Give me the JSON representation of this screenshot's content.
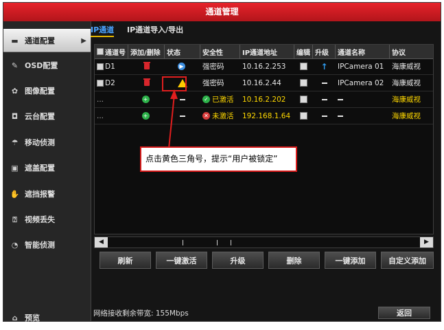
{
  "window": {
    "title": "通道管理"
  },
  "sidebar": {
    "items": [
      {
        "label": "通道配置",
        "icon": "camera-icon"
      },
      {
        "label": "OSD配置",
        "icon": "osd-icon"
      },
      {
        "label": "图像配置",
        "icon": "image-settings-icon"
      },
      {
        "label": "云台配置",
        "icon": "ptz-icon"
      },
      {
        "label": "移动侦测",
        "icon": "motion-detection-icon"
      },
      {
        "label": "遮盖配置",
        "icon": "privacy-mask-icon"
      },
      {
        "label": "遮挡报警",
        "icon": "tamper-alarm-icon"
      },
      {
        "label": "视频丢失",
        "icon": "video-loss-icon"
      },
      {
        "label": "智能侦测",
        "icon": "smart-detection-icon"
      }
    ],
    "preview_label": "预览"
  },
  "tabs": [
    {
      "label": "IP通道",
      "active": true
    },
    {
      "label": "IP通道导入/导出",
      "active": false
    }
  ],
  "table": {
    "headers": [
      "通道号",
      "添加/删除",
      "状态",
      "安全性",
      "IP通道地址",
      "编辑",
      "升级",
      "通道名称",
      "协议"
    ],
    "rows": [
      {
        "channel": "D1",
        "add_delete": "delete",
        "status": "play",
        "security": "强密码",
        "ip": "10.16.2.253",
        "edit": "edit",
        "upgrade": "upgrade",
        "name": "IPCamera 01",
        "protocol": "海康威视"
      },
      {
        "channel": "D2",
        "add_delete": "delete",
        "status": "warning",
        "security": "强密码",
        "ip": "10.16.2.44",
        "edit": "edit",
        "upgrade": "none",
        "name": "IPCamera 02",
        "protocol": "海康威视"
      },
      {
        "channel": "...",
        "add_delete": "add",
        "status": "none",
        "security": "已激活",
        "ip": "10.16.2.202",
        "edit": "edit",
        "upgrade": "none",
        "name": "—",
        "protocol": "海康威视"
      },
      {
        "channel": "...",
        "add_delete": "add",
        "status": "none",
        "security": "未激活",
        "ip": "192.168.1.64",
        "edit": "edit",
        "upgrade": "none",
        "name": "—",
        "protocol": "海康威视"
      }
    ]
  },
  "buttons": {
    "refresh": "刷新",
    "activate": "一键激活",
    "upgrade": "升级",
    "delete": "删除",
    "quick_add": "一键添加",
    "custom_add": "自定义添加",
    "back": "返回"
  },
  "footer": {
    "bandwidth": "网络接收剩余带宽: 155Mbps"
  },
  "annotation": {
    "callout": "点击黄色三角号，提示“用户被锁定”"
  },
  "colors": {
    "title_bar": "#d61d24",
    "accent_yellow": "#ffd800",
    "active_tab": "#4aa3ff",
    "annotation_red": "#e01e1e"
  }
}
